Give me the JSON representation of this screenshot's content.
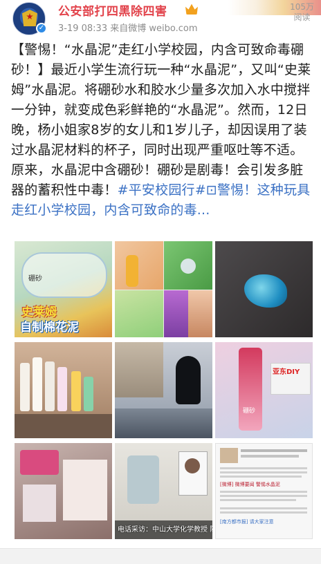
{
  "header": {
    "account_name": "公安部打四黑除四害",
    "meta": "3-19 08:33  来自微博 weibo.com",
    "view_count": "105万",
    "view_label": "阅读"
  },
  "post": {
    "seg1": "【警惕！“水晶泥”走红小学校园，内含可致命毒硼砂！】最近小学生流行玩一种“水晶泥”，又叫“史莱姆”水晶泥。将硼砂水和胶水少量多次加入水中搅拌一分钟，就变成色彩鲜艳的“水晶泥”。然而，12日晚，杨小姐家8岁的女儿和1岁儿子，却因误用了装过水晶泥材料的杯子，同时出现严重呕吐等不适。原来，水晶泥中含硼砂！硼砂是剧毒！会引发多脏器的蓄积性中毒！",
    "hashtag": "#平安校园行#",
    "link_icon": "⊡",
    "link_text": "警惕！这种玩具走红小学校园，内含可致命的毒..."
  },
  "images": {
    "t1_label_a": "史莱姆",
    "t1_label_b": "自制棉花泥",
    "t1_small": "硼砂",
    "t6_label": "亚东DIY",
    "t6_small": "硼砂",
    "t9_news_title": "[微博] 微博要闻 警惕水晶泥",
    "t8_caption": "电话采访：中山大学化学教授 陈六",
    "t9_caption": "[南方都市报] 请大家注意"
  }
}
